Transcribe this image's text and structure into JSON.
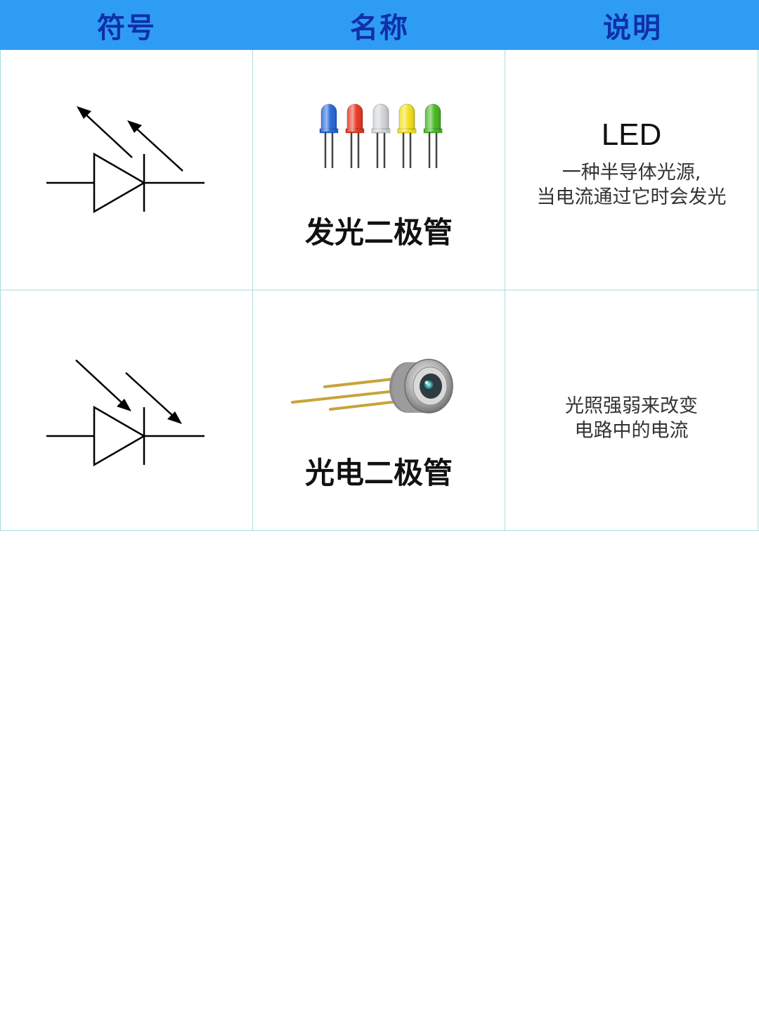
{
  "header": {
    "col_symbol": "符号",
    "col_name": "名称",
    "col_desc": "说明"
  },
  "rows": [
    {
      "name": "发光二极管",
      "abbr": "LED",
      "desc_line1": "一种半导体光源,",
      "desc_line2": "当电流通过它时会发光",
      "led_colors": [
        "#1e63d8",
        "#e8321c",
        "#cfd3d6",
        "#f2df12",
        "#3fb51c"
      ]
    },
    {
      "name": "光电二极管",
      "desc_line1": "光照强弱来改变",
      "desc_line2": "电路中的电流"
    }
  ],
  "colors": {
    "header_bg": "#2f9cf4",
    "header_text": "#0f2fa8",
    "grid_line": "#a9dedd"
  }
}
